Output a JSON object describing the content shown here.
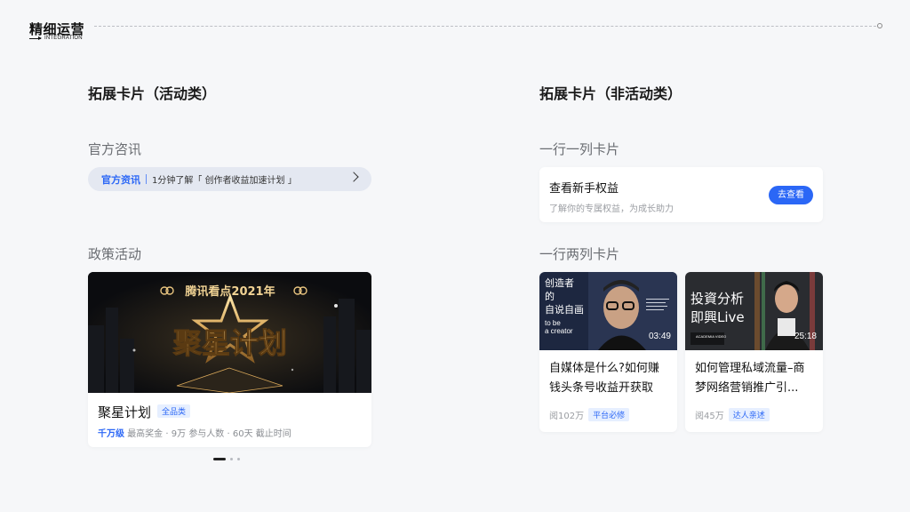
{
  "header": {
    "title": "精细运营",
    "subtitle": "INTEGRATION"
  },
  "left_column": {
    "title": "拓展卡片（活动类）",
    "official_section": {
      "title": "官方咨讯",
      "brand": "官方资讯",
      "text": "1分钟了解「 创作者收益加速计划 」"
    },
    "policy_section": {
      "title": "政策活动",
      "banner": {
        "headline": "腾讯看点2021年",
        "art_text": "聚星计划"
      },
      "card": {
        "name": "聚星计划",
        "badge": "全品类",
        "prize_value": "千万级",
        "prize_label": "最高奖金",
        "participants_value": "9万",
        "participants_label": "参与人数",
        "deadline_value": "60天",
        "deadline_label": "截止时间",
        "dot": "·"
      },
      "carousel": {
        "count": 3,
        "active": 0
      }
    }
  },
  "right_column": {
    "title": "拓展卡片（非活动类）",
    "single_section": {
      "title": "一行一列卡片",
      "card": {
        "title": "查看新手权益",
        "subtitle": "了解你的专属权益，为成长助力",
        "button": "去查看"
      }
    },
    "double_section": {
      "title": "一行两列卡片",
      "cards": [
        {
          "thumb_lines": [
            "创造者",
            "的",
            "自说自画"
          ],
          "thumb_en": [
            "to be",
            "a creator"
          ],
          "duration": "03:49",
          "title": "自媒体是什么?如何赚钱头条号收益开获取",
          "views": "阅102万",
          "tag": "平台必修"
        },
        {
          "thumb_lines": [
            "投資分析",
            "即興Live"
          ],
          "thumb_logo": "ACADEMIA VIDEO",
          "duration": "25:18",
          "title": "如何管理私域流量–商梦网络营销推广引...",
          "views": "阅45万",
          "tag": "达人亲述"
        }
      ]
    }
  },
  "colors": {
    "accent": "#2b67f6",
    "background": "#f6f7f9",
    "card": "#ffffff",
    "banner_gold": "#d9a85a"
  }
}
